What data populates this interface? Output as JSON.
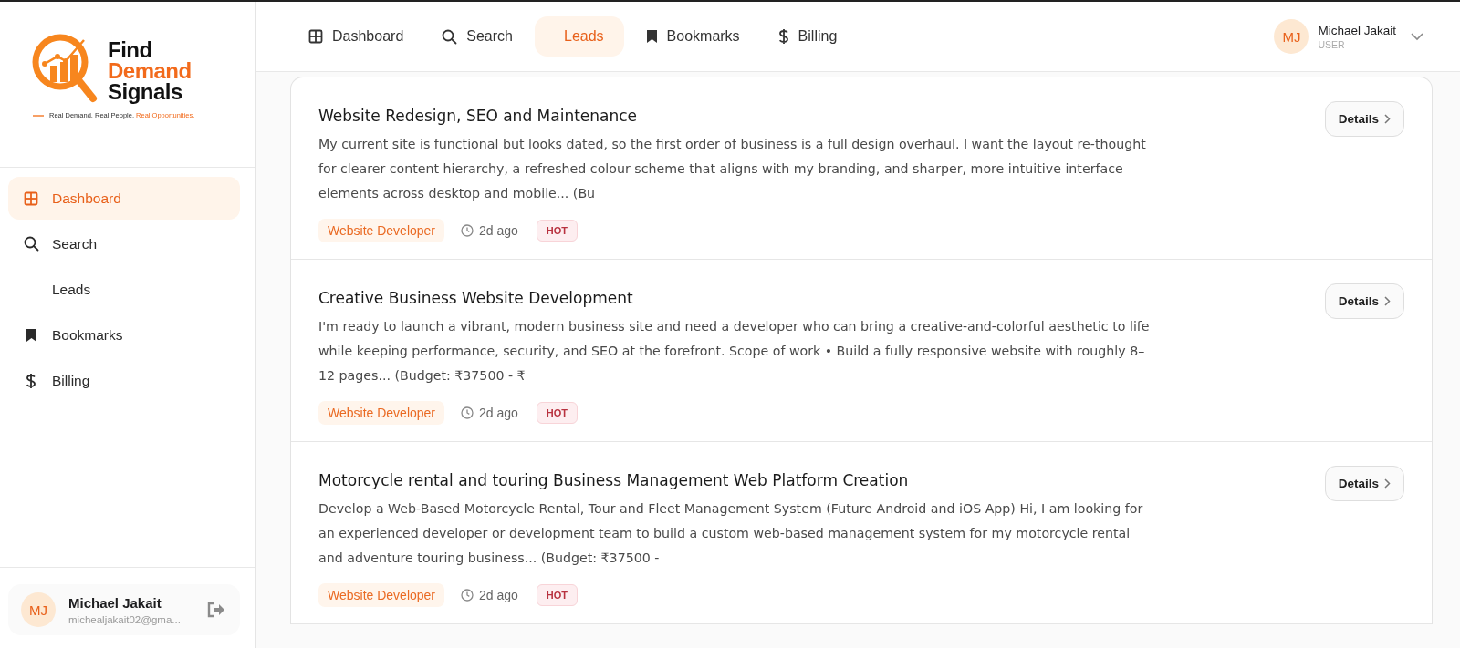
{
  "logo": {
    "line_1": "Find",
    "line_2": "Demand",
    "line_3": "Signals",
    "tagline": "Real Demand. Real People.",
    "tagline_highlight": "Real Opportunities."
  },
  "sidebar": {
    "items": [
      {
        "label": "Dashboard",
        "kind": "grid",
        "selected": true
      },
      {
        "label": "Search",
        "kind": "search",
        "selected": false
      },
      {
        "label": "Leads",
        "kind": "plain",
        "selected": false
      },
      {
        "label": "Bookmarks",
        "kind": "bookmark",
        "selected": false
      },
      {
        "label": "Billing",
        "kind": "dollar",
        "selected": false
      }
    ],
    "user": {
      "initials": "MJ",
      "name": "Michael Jakait",
      "email": "michealjakait02@gma..."
    }
  },
  "top_nav": {
    "items": [
      {
        "label": "Dashboard",
        "kind": "grid",
        "selected": false
      },
      {
        "label": "Search",
        "kind": "search",
        "selected": false
      },
      {
        "label": "Leads",
        "kind": "plain",
        "selected": true
      },
      {
        "label": "Bookmarks",
        "kind": "bookmark",
        "selected": false
      },
      {
        "label": "Billing",
        "kind": "dollar",
        "selected": false
      }
    ],
    "user": {
      "initials": "MJ",
      "name": "Michael Jakait",
      "role": "USER"
    }
  },
  "leads": [
    {
      "title": "Website Redesign, SEO and Maintenance",
      "description": "My current site is functional but looks dated, so the first order of business is a full design overhaul. I want the layout re-thought for clearer content hierarchy, a refreshed colour scheme that aligns with my branding, and sharper, more intuitive interface elements across desktop and mobile... (Bu",
      "category": "Website Developer",
      "age": "2d ago",
      "badge": "HOT",
      "button": "Details"
    },
    {
      "title": "Creative Business Website Development",
      "description": "I'm ready to launch a vibrant, modern business site and need a developer who can bring a creative-and-colorful aesthetic to life while keeping performance, security, and SEO at the forefront. Scope of work • Build a fully responsive website with roughly 8–12 pages... (Budget: ₹37500 - ₹",
      "category": "Website Developer",
      "age": "2d ago",
      "badge": "HOT",
      "button": "Details"
    },
    {
      "title": "Motorcycle rental and touring Business Management Web Platform Creation",
      "description": "Develop a Web-Based Motorcycle Rental, Tour and Fleet Management System (Future Android and iOS App) Hi, I am looking for an experienced developer or development team to build a custom web-based management system for my motorcycle rental and adventure touring business... (Budget: ₹37500 -",
      "category": "Website Developer",
      "age": "2d ago",
      "badge": "HOT",
      "button": "Details"
    }
  ]
}
